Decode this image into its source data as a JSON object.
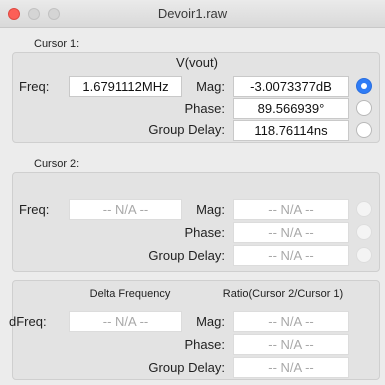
{
  "window": {
    "title": "Devoir1.raw"
  },
  "cursor1": {
    "label": "Cursor 1:",
    "trace": "V(vout)",
    "freq_label": "Freq:",
    "freq": "1.6791112MHz",
    "mag_label": "Mag:",
    "mag": "-3.0073377dB",
    "phase_label": "Phase:",
    "phase": "89.566939°",
    "gd_label": "Group Delay:",
    "gd": "118.76114ns"
  },
  "cursor2": {
    "label": "Cursor 2:",
    "freq_label": "Freq:",
    "freq": "-- N/A --",
    "mag_label": "Mag:",
    "mag": "-- N/A --",
    "phase_label": "Phase:",
    "phase": "-- N/A --",
    "gd_label": "Group Delay:",
    "gd": "-- N/A --"
  },
  "delta": {
    "freq_header": "Delta Frequency",
    "ratio_header": "Ratio(Cursor 2/Cursor 1)",
    "dfreq_label": "dFreq:",
    "dfreq": "-- N/A --",
    "mag_label": "Mag:",
    "mag": "-- N/A --",
    "phase_label": "Phase:",
    "phase": "-- N/A --",
    "gd_label": "Group Delay:",
    "gd": "-- N/A --"
  },
  "radios": {
    "cursor1_mag": "selected",
    "cursor1_phase": "unselected",
    "cursor1_gd": "unselected",
    "cursor2_mag": "disabled",
    "cursor2_phase": "disabled",
    "cursor2_gd": "disabled"
  },
  "colors": {
    "accent": "#2f7cf6",
    "close": "#fc5f57"
  }
}
